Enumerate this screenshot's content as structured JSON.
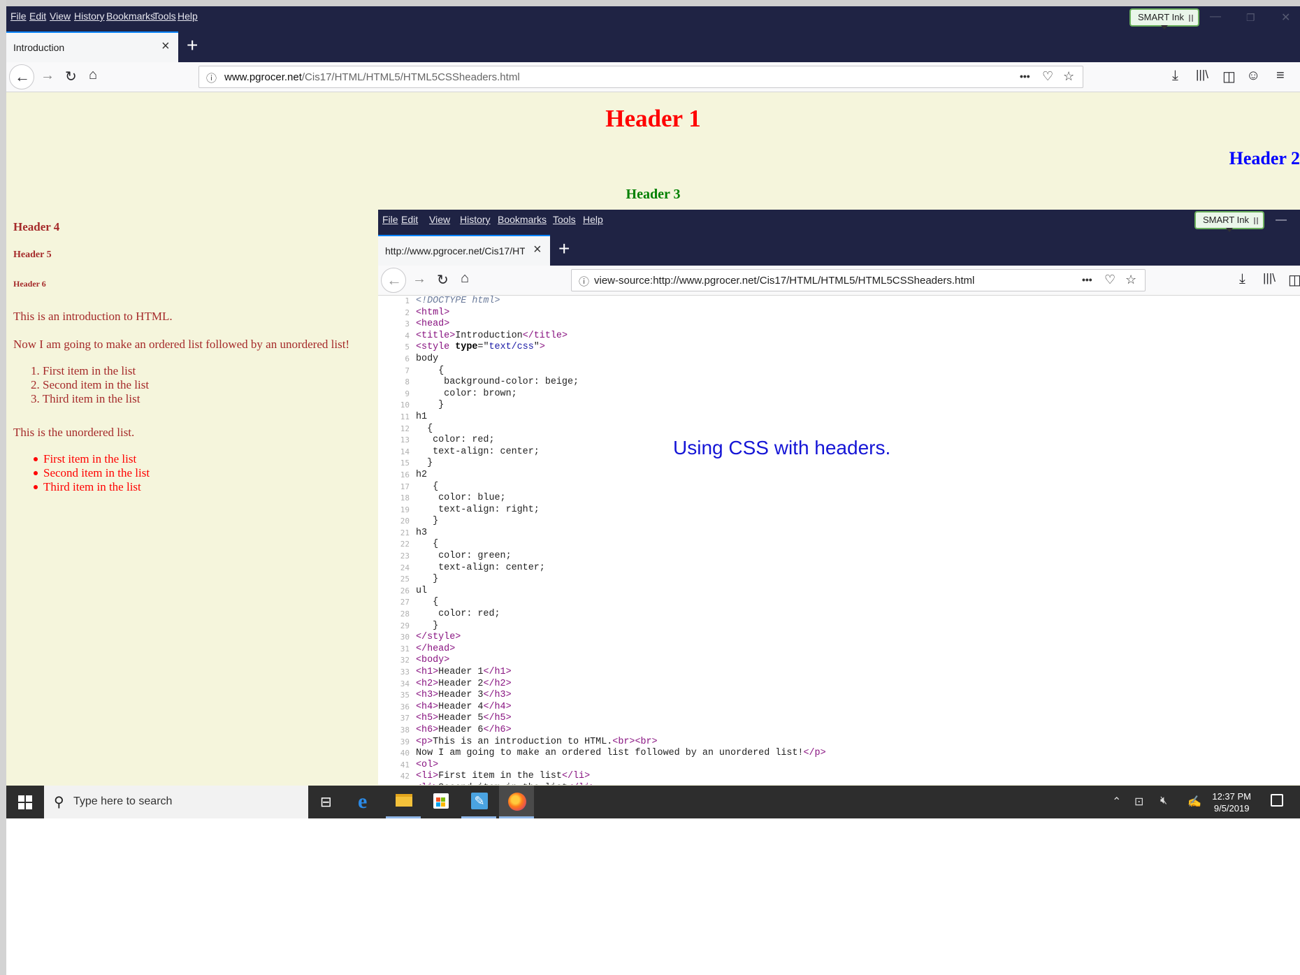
{
  "browser_main": {
    "menu": [
      "File",
      "Edit",
      "View",
      "History",
      "Bookmarks",
      "Tools",
      "Help"
    ],
    "smart_ink": "SMART Ink",
    "tab_title": "Introduction",
    "tab_close": "×",
    "new_tab": "+",
    "url_host": "www.pgrocer.net",
    "url_path": "/Cis17/HTML/HTML5/HTML5CSSheaders.html",
    "page_actions": "•••"
  },
  "page": {
    "h1": "Header 1",
    "h2": "Header 2",
    "h3": "Header 3",
    "h4": "Header 4",
    "h5": "Header 5",
    "h6": "Header 6",
    "p1": "This is an introduction to HTML.",
    "p2": "Now I am going to make an ordered list followed by an unordered list!",
    "ordered_list": [
      "First item in the list",
      "Second item in the list",
      "Third item in the list"
    ],
    "p3": "This is the unordered list.",
    "unordered_list": [
      "First item in the list",
      "Second item in the list",
      "Third item in the list"
    ]
  },
  "browser_source": {
    "menu": [
      "File",
      "Edit",
      "View",
      "History",
      "Bookmarks",
      "Tools",
      "Help"
    ],
    "smart_ink": "SMART Ink",
    "tab_title": "http://www.pgrocer.net/Cis17/HTM",
    "tab_close": "×",
    "new_tab": "+",
    "url": "view-source:http://www.pgrocer.net/Cis17/HTML/HTML5/HTML5CSSheaders.html",
    "page_actions": "•••",
    "annotation": "Using CSS with headers."
  },
  "source_lines": [
    "<!DOCTYPE html>",
    "<html>",
    "<head>",
    "<title>Introduction</title>",
    "<style type=\"text/css\">",
    "body",
    "    {",
    "     background-color: beige;",
    "     color: brown;",
    "    }",
    "h1",
    "  {",
    "   color: red;",
    "   text-align: center;",
    "  }",
    "h2",
    "   {",
    "    color: blue;",
    "    text-align: right;",
    "   }",
    "h3",
    "   {",
    "    color: green;",
    "    text-align: center;",
    "   }",
    "ul",
    "   {",
    "    color: red;",
    "   }",
    "</style>",
    "</head>",
    "<body>",
    "<h1>Header 1</h1>",
    "<h2>Header 2</h2>",
    "<h3>Header 3</h3>",
    "<h4>Header 4</h4>",
    "<h5>Header 5</h5>",
    "<h6>Header 6</h6>",
    "<p>This is an introduction to HTML.<br><br>",
    "Now I am going to make an ordered list followed by an unordered list!</p>",
    "<ol>",
    "<li>First item in the list</li>",
    "<li>Second item in the list</li>"
  ],
  "taskbar": {
    "search_placeholder": "Type here to search",
    "time": "12:37 PM",
    "date": "9/5/2019",
    "pinned": [
      "task-view",
      "edge",
      "file-explorer",
      "store",
      "notepad",
      "firefox"
    ]
  }
}
